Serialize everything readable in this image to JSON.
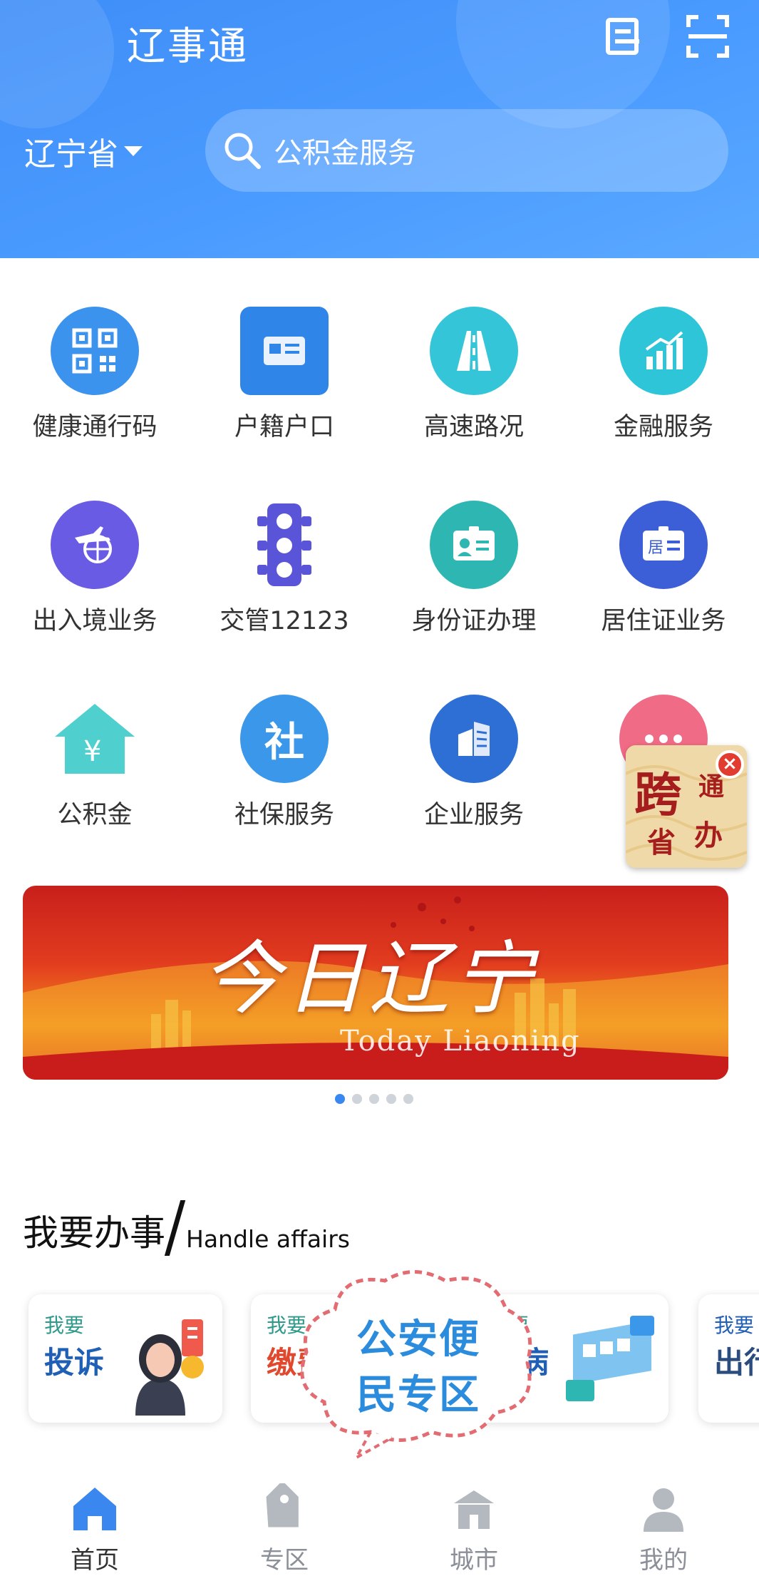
{
  "header": {
    "app_title": "辽事通",
    "province": "辽宁省",
    "search_placeholder": "公积金服务"
  },
  "services": [
    {
      "label": "健康通行码",
      "icon": "qr-code-icon",
      "color": "#3c93ee"
    },
    {
      "label": "户籍户口",
      "icon": "id-card-book-icon",
      "color": "#2f86e8"
    },
    {
      "label": "高速路况",
      "icon": "highway-icon",
      "color": "#34c6d8"
    },
    {
      "label": "金融服务",
      "icon": "bar-chart-icon",
      "color": "#2ec5d8"
    },
    {
      "label": "出入境业务",
      "icon": "airplane-globe-icon",
      "color": "#6a5be4"
    },
    {
      "label": "交管12123",
      "icon": "traffic-light-icon",
      "color": "#5a55d8"
    },
    {
      "label": "身份证办理",
      "icon": "id-card-icon",
      "color": "#2eb6b2"
    },
    {
      "label": "居住证业务",
      "icon": "residence-card-icon",
      "color": "#3c5ed6"
    },
    {
      "label": "公积金",
      "icon": "house-yuan-icon",
      "color": "#4fd0cf"
    },
    {
      "label": "社保服务",
      "icon": "social-security-icon",
      "color": "#3b97ea"
    },
    {
      "label": "企业服务",
      "icon": "building-icon",
      "color": "#2e6fd6"
    },
    {
      "label": "",
      "icon": "more-icon",
      "color": "#f06b86"
    }
  ],
  "float_badge": {
    "big": "跨",
    "small1": "通",
    "small2": "省",
    "small3": "办"
  },
  "banner": {
    "cn": "今日辽宁",
    "en": "Today Liaoning"
  },
  "section": {
    "cn": "我要办事",
    "en": "Handle affairs"
  },
  "cards": [
    {
      "small": "我要",
      "big": "投诉"
    },
    {
      "small": "我要",
      "big": "缴费"
    },
    {
      "small": "我要",
      "big": "看病"
    },
    {
      "small": "我要",
      "big": "出行"
    }
  ],
  "promo": {
    "line1": "公安便",
    "line2": "民专区"
  },
  "tabs": [
    {
      "label": "首页",
      "icon": "home-icon"
    },
    {
      "label": "专区",
      "icon": "tag-icon"
    },
    {
      "label": "城市",
      "icon": "city-gate-icon"
    },
    {
      "label": "我的",
      "icon": "user-icon"
    }
  ]
}
